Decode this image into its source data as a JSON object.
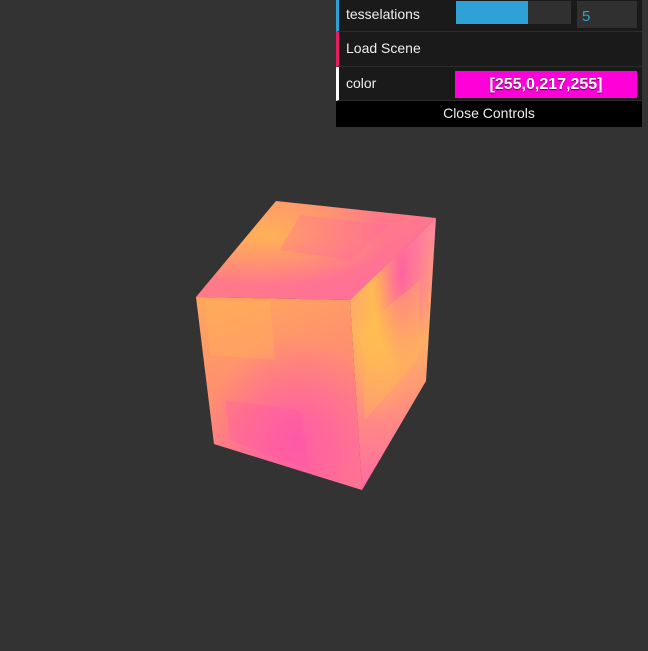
{
  "controls": {
    "tesselations": {
      "label": "tesselations",
      "value": "5",
      "fraction": 0.625
    },
    "load_scene": {
      "label": "Load Scene"
    },
    "color": {
      "label": "color",
      "value": "[255,0,217,255]",
      "swatch_hex": "#ff00d9"
    },
    "close_label": "Close Controls"
  },
  "colors": {
    "background": "#333333",
    "panel_bg": "#1a1a1a",
    "number_accent": "#2fa1d6",
    "function_accent": "#e61d5f",
    "cube_warm": "#ffbf55",
    "cube_pink": "#ff5fa8"
  }
}
